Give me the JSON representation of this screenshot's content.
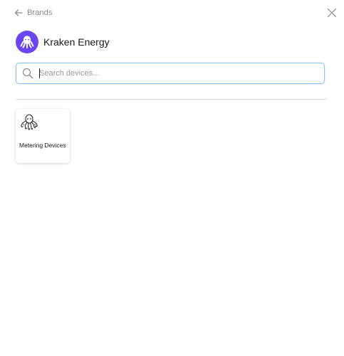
{
  "header": {
    "back_label": "Brands",
    "back_icon": "arrow-left-icon",
    "close_icon": "close-icon"
  },
  "brand": {
    "name": "Kraken Energy",
    "logo_icon": "kraken-octopus-logo",
    "logo_color": "#6b46f2"
  },
  "search": {
    "placeholder": "Search devices...",
    "value": "",
    "icon": "search-icon",
    "focus_color": "#8cc4ef"
  },
  "devices": [
    {
      "label": "Metering Devices",
      "icon": "octopus-icon"
    }
  ]
}
